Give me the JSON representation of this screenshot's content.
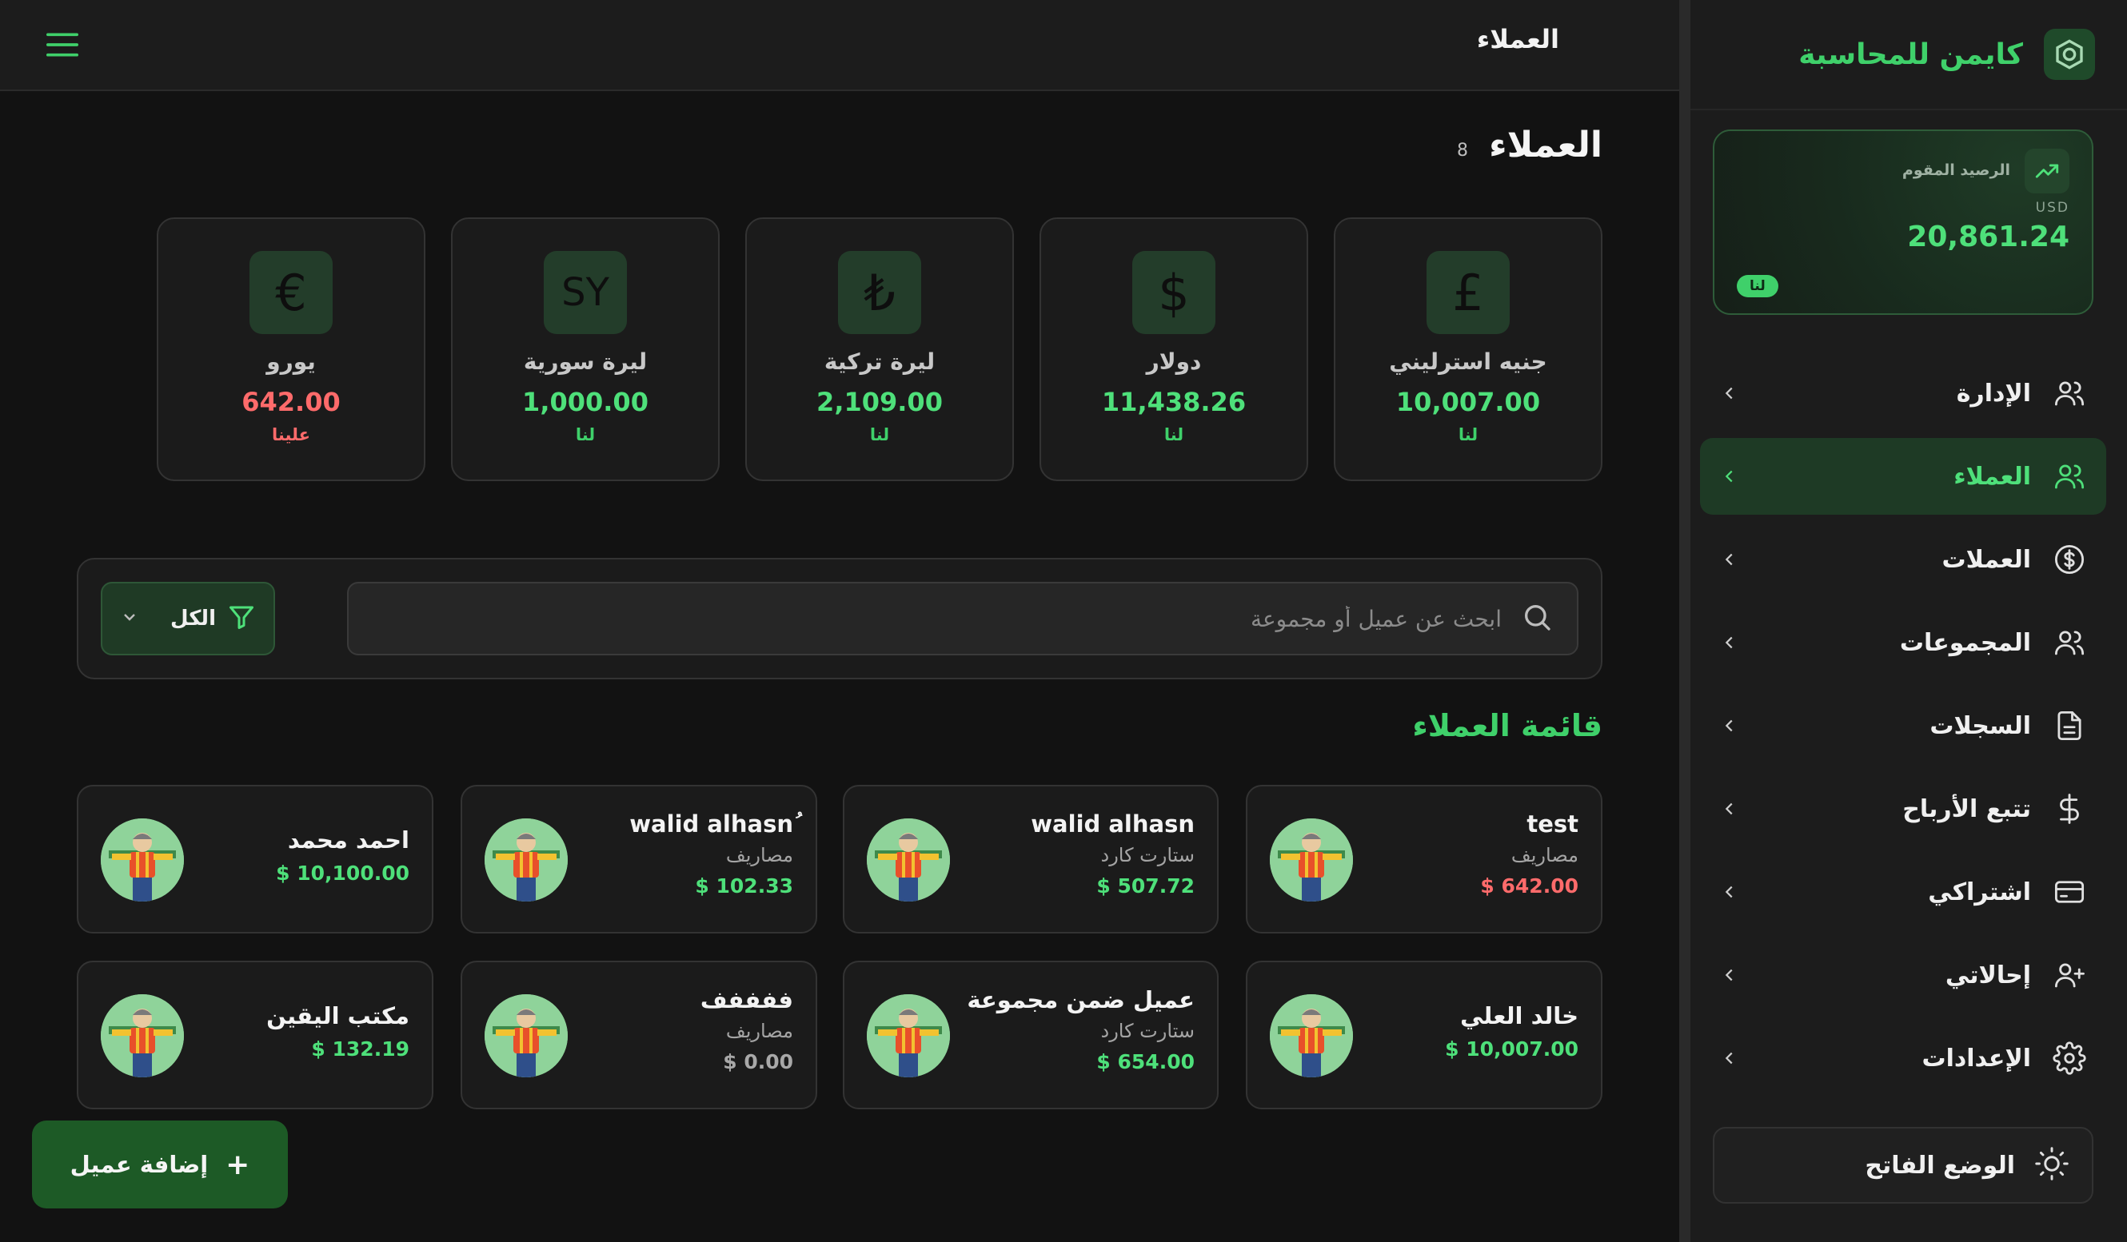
{
  "sidebar": {
    "brand_name": "كايمن للمحاسبة",
    "balance": {
      "label": "الرصيد المقوم",
      "currency": "USD",
      "value": "20,861.24",
      "badge": "لنا"
    },
    "nav": [
      {
        "label": "الإدارة",
        "icon": "users-icon"
      },
      {
        "label": "العملاء",
        "icon": "users-icon",
        "active": true
      },
      {
        "label": "العملات",
        "icon": "dollar-circle-icon"
      },
      {
        "label": "المجموعات",
        "icon": "users-icon"
      },
      {
        "label": "السجلات",
        "icon": "document-icon"
      },
      {
        "label": "تتبع الأرباح",
        "icon": "dollar-icon"
      },
      {
        "label": "اشتراكي",
        "icon": "credit-card-icon"
      },
      {
        "label": "إحالاتي",
        "icon": "user-plus-icon"
      },
      {
        "label": "الإعدادات",
        "icon": "gear-icon"
      }
    ],
    "theme_toggle": "الوضع الفاتح"
  },
  "topbar": {
    "title": "العملاء"
  },
  "page": {
    "title": "العملاء",
    "count": "8"
  },
  "currencies": [
    {
      "symbol": "£",
      "name": "جنيه استرليني",
      "amount": "10,007.00",
      "status": "لنا"
    },
    {
      "symbol": "$",
      "name": "دولار",
      "amount": "11,438.26",
      "status": "لنا"
    },
    {
      "symbol": "₺",
      "name": "ليرة تركية",
      "amount": "2,109.00",
      "status": "لنا"
    },
    {
      "symbol": "SY",
      "name": "ليرة سورية",
      "amount": "1,000.00",
      "status": "لنا"
    },
    {
      "symbol": "€",
      "name": "يورو",
      "amount": "642.00",
      "status": "علينا"
    }
  ],
  "search": {
    "placeholder": "ابحث عن عميل أو مجموعة",
    "value": ""
  },
  "filter": {
    "selected": "الكل"
  },
  "list": {
    "title": "قائمة العملاء"
  },
  "clients": [
    {
      "name": "test",
      "group": "مصاريف",
      "balance": "$ 642.00"
    },
    {
      "name": "walid alhasn",
      "group": "ستارت كارد",
      "balance": "$ 507.72"
    },
    {
      "name": "walid alhasnُ",
      "group": "مصاريف",
      "balance": "$ 102.33"
    },
    {
      "name": "احمد محمد",
      "group": "",
      "balance": "$ 10,100.00"
    },
    {
      "name": "خالد العلي",
      "group": "",
      "balance": "$ 10,007.00"
    },
    {
      "name": "عميل ضمن مجموعة",
      "group": "ستارت كارد",
      "balance": "$ 654.00"
    },
    {
      "name": "ففففف",
      "group": "مصاريف",
      "balance": "$ 0.00"
    },
    {
      "name": "مكتب اليقين",
      "group": "",
      "balance": "$ 132.19"
    }
  ],
  "add_button": {
    "label": "إضافة عميل",
    "icon": "+"
  },
  "colors": {
    "accent": "#3fd06a",
    "positive": "#4ee07a",
    "negative": "#ff6b6b",
    "background": "#121212",
    "surface": "#1b1b1b"
  }
}
